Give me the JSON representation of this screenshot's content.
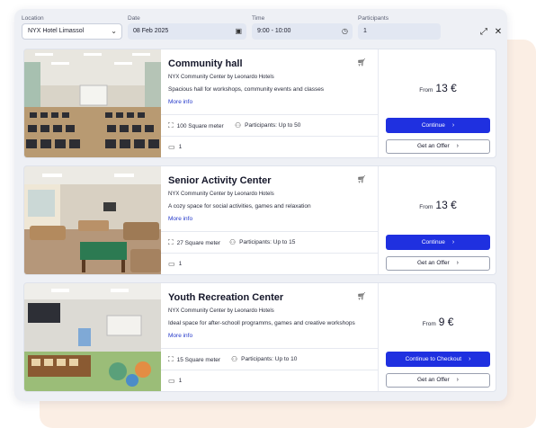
{
  "filters": {
    "location": {
      "label": "Location",
      "value": "NYX Hotel Limassol"
    },
    "date": {
      "label": "Date",
      "value": "08 Feb 2025"
    },
    "time": {
      "label": "Time",
      "value": "9:00 - 10:00"
    },
    "participants": {
      "label": "Participants",
      "value": "1"
    }
  },
  "window_controls": {
    "expand_icon": "expand-icon",
    "close_icon": "close-icon"
  },
  "rooms": [
    {
      "title": "Community hall",
      "venue": "NYX Community Center by Leonardo Hotels",
      "description": "Spacious hall for workshops, community events and classes",
      "more_info": "More info",
      "size": "100 Square meter",
      "participants": "Participants: Up to 50",
      "beds": "1",
      "price_prefix": "From",
      "price": "13 €",
      "primary_button": "Continue",
      "secondary_button": "Get an Offer"
    },
    {
      "title": "Senior Activity Center",
      "venue": "NYX Community Center by Leonardo Hotels",
      "description": "A cozy space for social activities, games and relaxation",
      "more_info": "More info",
      "size": "27 Square meter",
      "participants": "Participants: Up to 15",
      "beds": "1",
      "price_prefix": "From",
      "price": "13 €",
      "primary_button": "Continue",
      "secondary_button": "Get an Offer"
    },
    {
      "title": "Youth Recreation Center",
      "venue": "NYX Community Center by Leonardo Hotels",
      "description": "Ideal space for after-schooll programms, games and creative workshops",
      "more_info": "More info",
      "size": "15 Square meter",
      "participants": "Participants: Up to 10",
      "beds": "1",
      "price_prefix": "From",
      "price": "9 €",
      "primary_button": "Continue to Checkout",
      "secondary_button": "Get an Offer"
    }
  ],
  "colors": {
    "accent": "#1f30e0",
    "link": "#2438c9",
    "panel": "#eef0f5",
    "backdrop": "#fbeee4"
  }
}
